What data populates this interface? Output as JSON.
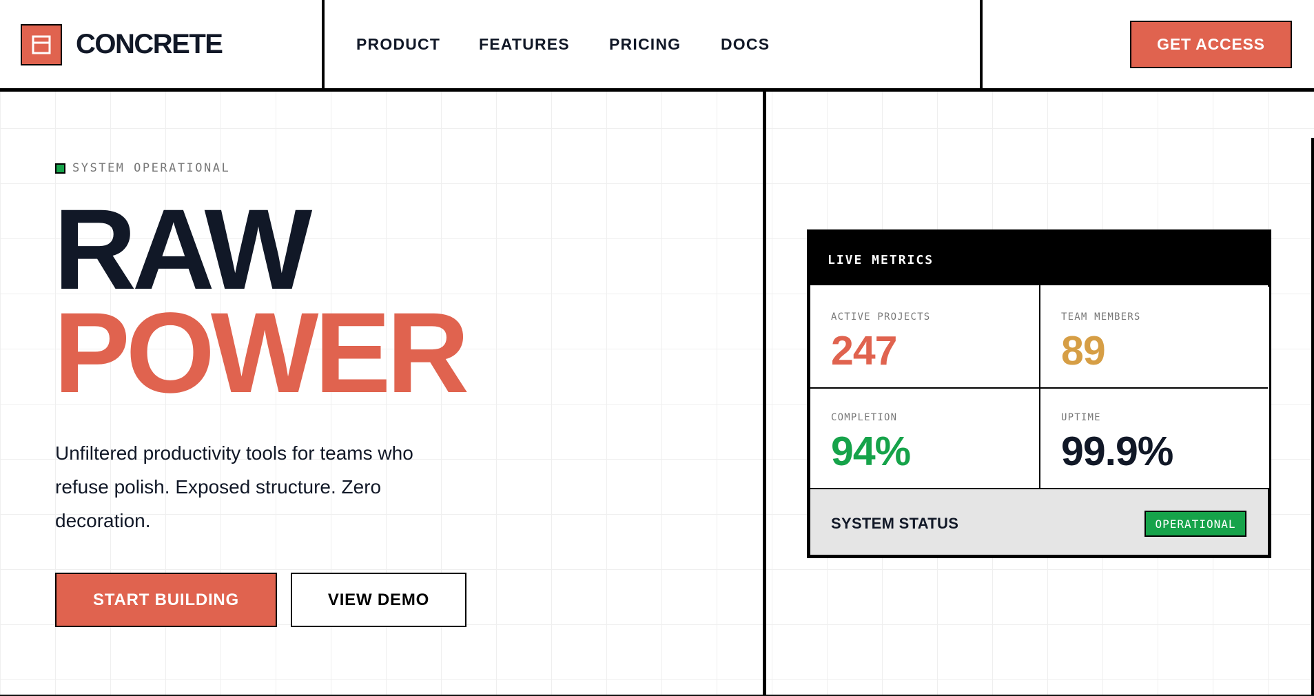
{
  "brand": {
    "name": "CONCRETE",
    "logo_icon": "window-icon"
  },
  "nav": {
    "items": [
      "PRODUCT",
      "FEATURES",
      "PRICING",
      "DOCS"
    ]
  },
  "header": {
    "cta_label": "GET ACCESS"
  },
  "hero": {
    "status": "SYSTEM OPERATIONAL",
    "title_line1": "RAW",
    "title_line2": "POWER",
    "subtitle": "Unfiltered productivity tools for teams who refuse polish. Exposed structure. Zero decoration.",
    "primary_button": "START BUILDING",
    "secondary_button": "VIEW DEMO"
  },
  "metrics": {
    "title": "LIVE METRICS",
    "cells": [
      {
        "label": "ACTIVE PROJECTS",
        "value": "247",
        "color": "#E0634F"
      },
      {
        "label": "TEAM MEMBERS",
        "value": "89",
        "color": "#D69E45"
      },
      {
        "label": "COMPLETION",
        "value": "94%",
        "color": "#16A34A"
      },
      {
        "label": "UPTIME",
        "value": "99.9%",
        "color": "#111827"
      }
    ],
    "footer_label": "SYSTEM STATUS",
    "footer_badge": "OPERATIONAL"
  },
  "colors": {
    "accent": "#E0634F",
    "success": "#16A34A",
    "ink": "#111827",
    "gold": "#D69E45"
  }
}
